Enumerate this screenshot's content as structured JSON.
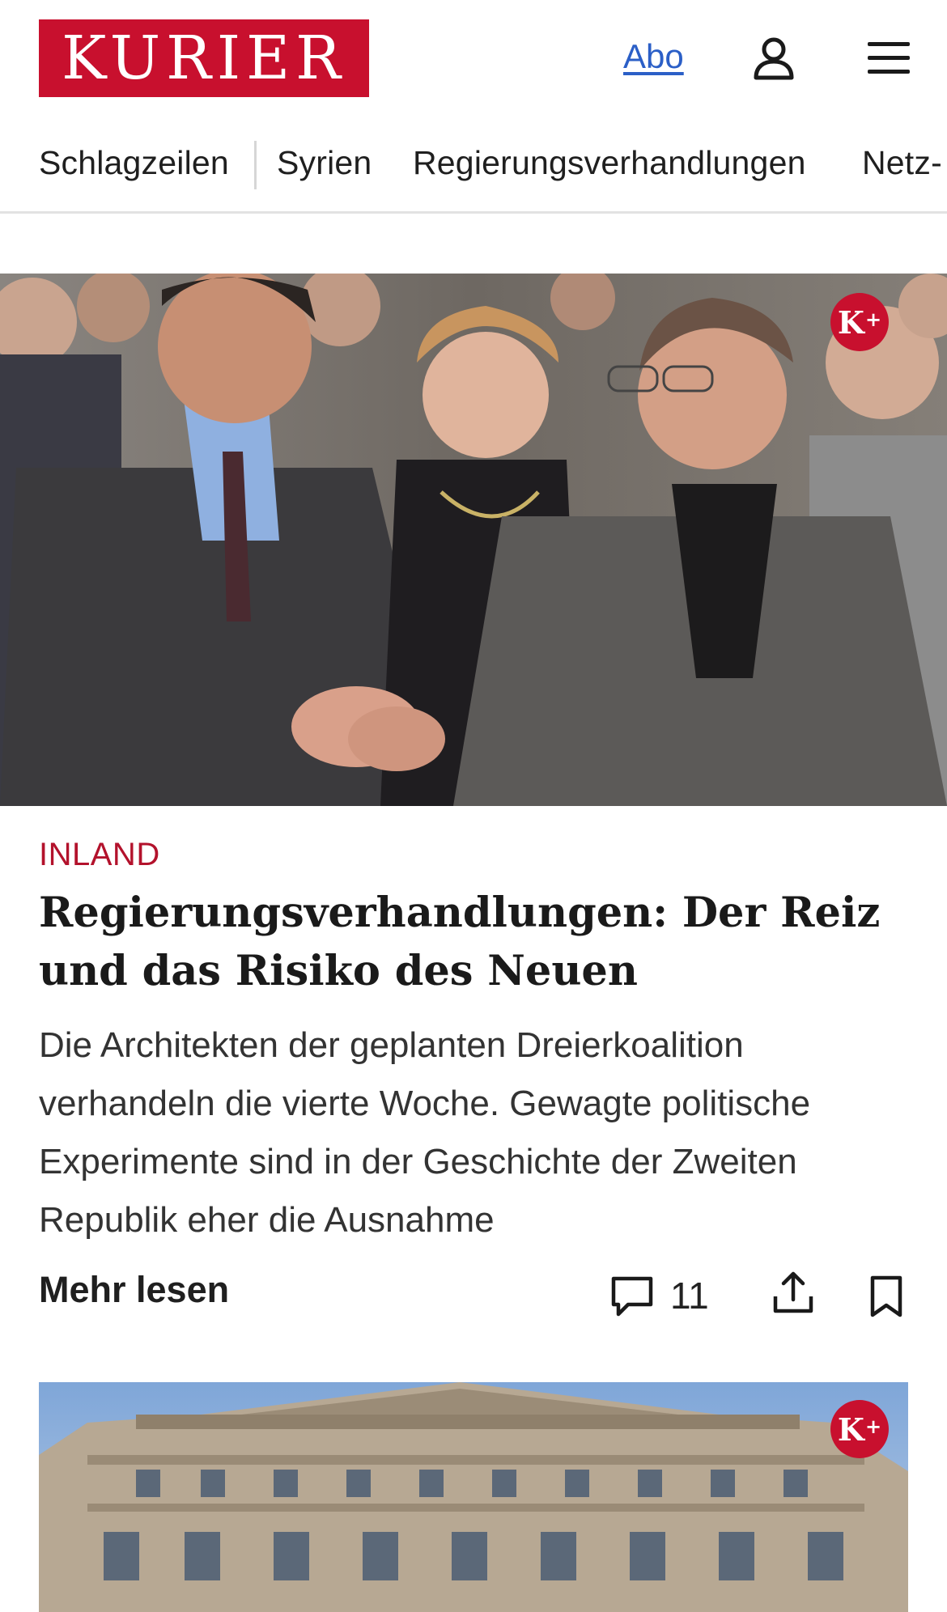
{
  "header": {
    "logo_text": "KURIER",
    "abo_label": "Abo",
    "user_icon": "user-icon",
    "menu_icon": "hamburger-menu-icon"
  },
  "nav": {
    "items": [
      "Schlagzeilen",
      "Syrien",
      "Regierungsverhandlungen",
      "Netz-"
    ]
  },
  "article": {
    "image_badge": "K+",
    "category": "INLAND",
    "headline": "Regierungsverhandlungen: Der Reiz und das Risiko des Neuen",
    "teaser": "Die Architekten der geplanten Dreierkoalition verhandeln die vierte Woche. Gewagte politische Experimente sind in der Geschichte der Zweiten Republik eher die Ausnahme",
    "more_label": "Mehr lesen",
    "comment_count": "11",
    "comment_icon": "comment-icon",
    "share_icon": "share-icon",
    "bookmark_icon": "bookmark-icon"
  },
  "next_article": {
    "image_badge": "K+"
  },
  "colors": {
    "brand_red": "#c8102e",
    "category_red": "#b3122c",
    "link_blue": "#2b5fc7"
  }
}
